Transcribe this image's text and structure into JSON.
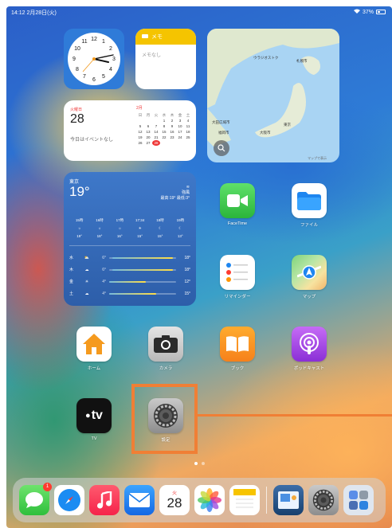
{
  "status_bar": {
    "time_date": "14:12  2月28日(火)",
    "battery": "37%"
  },
  "notes_widget": {
    "title": "メモ",
    "body": "メモなし"
  },
  "calendar_widget": {
    "weekday": "火曜日",
    "day": "28",
    "no_events": "今日はイベントなし",
    "month": "2月",
    "header": [
      "日",
      "月",
      "火",
      "水",
      "木",
      "金",
      "土"
    ],
    "weeks": [
      [
        "",
        "",
        "",
        "1",
        "2",
        "3",
        "4"
      ],
      [
        "5",
        "6",
        "7",
        "8",
        "9",
        "10",
        "11"
      ],
      [
        "12",
        "13",
        "14",
        "15",
        "16",
        "17",
        "18"
      ],
      [
        "19",
        "20",
        "21",
        "22",
        "23",
        "24",
        "25"
      ],
      [
        "26",
        "27",
        "28",
        "",
        "",
        "",
        ""
      ]
    ],
    "today": "28"
  },
  "map_widget": {
    "labels": [
      "ウラジオストク",
      "札幌市",
      "大田広域市",
      "福岡市",
      "東京",
      "大阪市",
      "マップで表示"
    ]
  },
  "weather_widget": {
    "city": "東京",
    "temp": "19°",
    "condition": "強風",
    "high_low": "最高:19° 最低:3°",
    "hours": [
      "15時",
      "16時",
      "17時",
      "17:34",
      "18時",
      "19時"
    ],
    "hour_icons": [
      "☼",
      "☼",
      "☼",
      "☀",
      "☾",
      "☾"
    ],
    "hour_temps": [
      "19°",
      "18°",
      "16°",
      "15°",
      "15°",
      "13°"
    ],
    "days": [
      {
        "day": "水",
        "icon": "⛅",
        "lo": "6°",
        "hi": "18°",
        "bar_start": 0.05,
        "bar_end": 0.95
      },
      {
        "day": "木",
        "icon": "☁",
        "lo": "6°",
        "hi": "18°",
        "bar_start": 0.05,
        "bar_end": 0.95
      },
      {
        "day": "金",
        "icon": "☀",
        "lo": "4°",
        "hi": "12°",
        "bar_start": 0.0,
        "bar_end": 0.55
      },
      {
        "day": "土",
        "icon": "☁",
        "lo": "4°",
        "hi": "15°",
        "bar_start": 0.0,
        "bar_end": 0.7
      }
    ]
  },
  "apps": {
    "facetime": "FaceTime",
    "files": "ファイル",
    "reminders": "リマインダー",
    "maps": "マップ",
    "home": "ホーム",
    "camera": "カメラ",
    "books": "ブック",
    "podcasts": "ポッドキャスト",
    "tv": "TV",
    "tv_logo": "tv",
    "settings": "設定"
  },
  "dock": {
    "messages_badge": "1",
    "calendar_weekday": "火",
    "calendar_day": "28"
  },
  "colors": {
    "highlight": "#f07f35"
  }
}
